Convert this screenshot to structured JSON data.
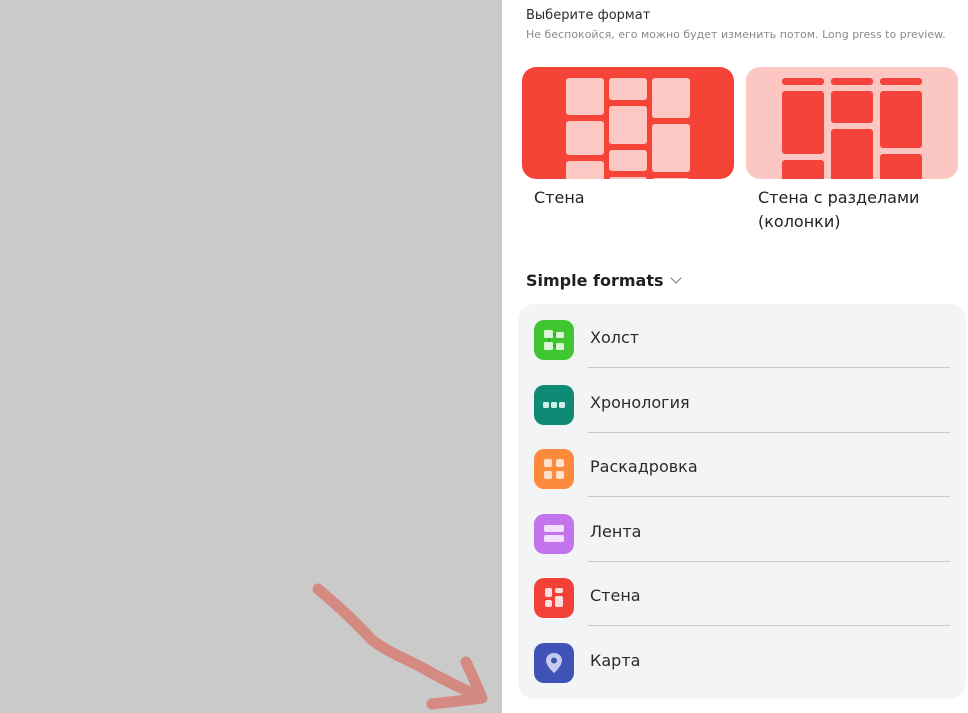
{
  "header": {
    "title": "Выберите формат",
    "subtitle": "Не беспокойся, его можно будет изменить потом. Long press to preview."
  },
  "featured": [
    {
      "label": "Стена",
      "icon": "wall-preview",
      "color": "#f64337"
    },
    {
      "label": "Стена с разделами (колонки)",
      "icon": "columns-preview",
      "color": "#fcc6c3"
    }
  ],
  "simple_formats": {
    "label": "Simple formats",
    "items": [
      {
        "label": "Холст",
        "icon": "canvas-icon",
        "color": "#3fc631"
      },
      {
        "label": "Хронология",
        "icon": "timeline-icon",
        "color": "#0f8a74"
      },
      {
        "label": "Раскадровка",
        "icon": "grid-icon",
        "color": "#fd8a3d"
      },
      {
        "label": "Лента",
        "icon": "stream-icon",
        "color": "#c374ec"
      },
      {
        "label": "Стена",
        "icon": "wall-icon",
        "color": "#f44137"
      },
      {
        "label": "Карта",
        "icon": "map-pin-icon",
        "color": "#3f52b5"
      }
    ]
  }
}
